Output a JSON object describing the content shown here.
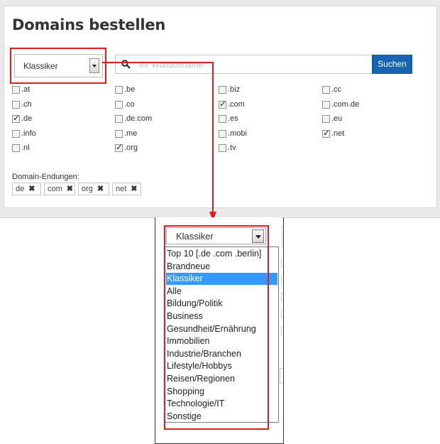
{
  "page": {
    "title": "Domains bestellen"
  },
  "category_select": {
    "value": "Klassiker"
  },
  "search": {
    "placeholder": "Ihr Wunschname",
    "button_label": "Suchen"
  },
  "tlds": [
    {
      "label": ".at",
      "checked": false
    },
    {
      "label": ".be",
      "checked": false
    },
    {
      "label": ".biz",
      "checked": false
    },
    {
      "label": ".cc",
      "checked": false
    },
    {
      "label": ".ch",
      "checked": false
    },
    {
      "label": ".co",
      "checked": false
    },
    {
      "label": ".com",
      "checked": true
    },
    {
      "label": ".com.de",
      "checked": false
    },
    {
      "label": ".de",
      "checked": true
    },
    {
      "label": ".de.com",
      "checked": false
    },
    {
      "label": ".es",
      "checked": false
    },
    {
      "label": ".eu",
      "checked": false
    },
    {
      "label": ".info",
      "checked": false
    },
    {
      "label": ".me",
      "checked": false
    },
    {
      "label": ".mobi",
      "checked": false
    },
    {
      "label": ".net",
      "checked": true
    },
    {
      "label": ".nl",
      "checked": false
    },
    {
      "label": ".org",
      "checked": true
    },
    {
      "label": ".tv",
      "checked": false
    }
  ],
  "endings": {
    "label": "Domain-Endungen:",
    "tags": [
      "de",
      "com",
      "org",
      "net"
    ],
    "remove_glyph": "✖"
  },
  "dropdown_zoom": {
    "value": "Klassiker",
    "options": [
      "Top 10 [.de .com .berlin]",
      "Brandneue",
      "Klassiker",
      "Alle",
      "Bildung/Politik",
      "Business",
      "Gesundheit/Ernährung",
      "Immobilien",
      "Industrie/Branchen",
      "Lifestyle/Hobbys",
      "Reisen/Regionen",
      "Shopping",
      "Technologie/IT",
      "Sonstige"
    ],
    "selected_index": 2
  },
  "colors": {
    "accent_button": "#1565b2",
    "highlight_red": "#e21b1b",
    "selected_option": "#3399ff"
  }
}
